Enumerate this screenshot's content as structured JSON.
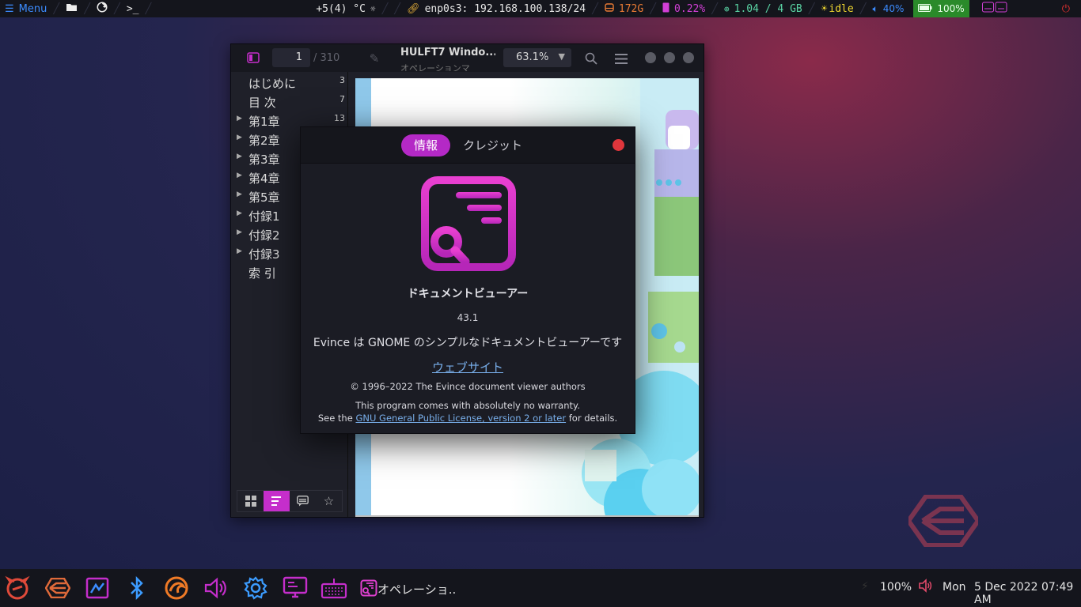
{
  "topbar": {
    "menu_label": "Menu",
    "weather": "+5(4) °C",
    "network": "enp0s3: 192.168.100.138/24",
    "disk": "172G",
    "cpu": "0.22%",
    "memory": "1.04 / 4 GB",
    "status": "idle",
    "volume": "40%",
    "battery": "100%"
  },
  "window": {
    "page_current": "1",
    "page_total": "/ 310",
    "doc_title": "HULFT7 Windo...",
    "doc_subtitle": "オペレーションマ",
    "zoom": "63.1%"
  },
  "toc": [
    {
      "label": "はじめに",
      "page": "3",
      "expandable": false
    },
    {
      "label": "目 次",
      "page": "7",
      "expandable": false
    },
    {
      "label": "第1章",
      "page": "13",
      "expandable": true
    },
    {
      "label": "第2章",
      "page": "",
      "expandable": true
    },
    {
      "label": "第3章",
      "page": "",
      "expandable": true
    },
    {
      "label": "第4章",
      "page": "",
      "expandable": true
    },
    {
      "label": "第5章",
      "page": "",
      "expandable": true
    },
    {
      "label": "付録1",
      "page": "",
      "expandable": true
    },
    {
      "label": "付録2",
      "page": "",
      "expandable": true
    },
    {
      "label": "付録3",
      "page": "",
      "expandable": true
    },
    {
      "label": "索 引",
      "page": "",
      "expandable": false
    }
  ],
  "about": {
    "tab_info": "情報",
    "tab_credits": "クレジット",
    "app_name": "ドキュメントビューアー",
    "version": "43.1",
    "description": "Evince は GNOME のシンプルなドキュメントビューアーです",
    "website": "ウェブサイト",
    "copyright": "© 1996–2022 The Evince document viewer authors",
    "warranty": "This program comes with absolutely no warranty.",
    "license_prefix": "See the ",
    "license_link": "GNU General Public License, version 2 or later",
    "license_suffix": " for details."
  },
  "taskbar": {
    "task_label": "オペレーショ..",
    "brightness": "100%",
    "day": "Mon",
    "datetime": "5 Dec 2022 07:49 AM"
  },
  "colors": {
    "accent": "#b429c6",
    "close": "#e0363c",
    "link": "#78aeea"
  }
}
